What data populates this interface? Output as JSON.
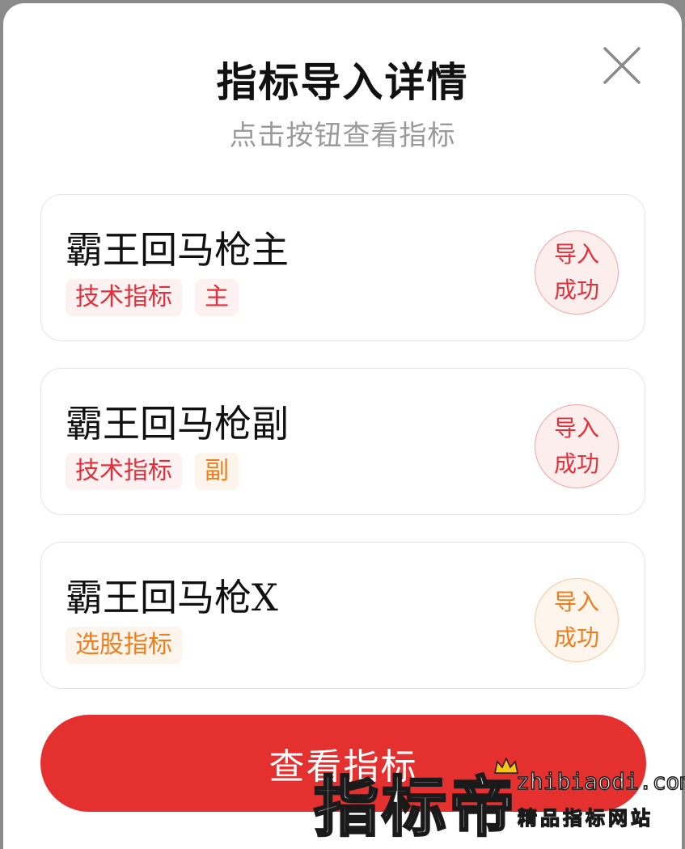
{
  "dialog": {
    "title": "指标导入详情",
    "subtitle": "点击按钮查看指标",
    "close_icon": "close-icon"
  },
  "indicators": [
    {
      "name": "霸王回马枪主",
      "tags": [
        {
          "label": "技术指标",
          "color": "#e0303a"
        },
        {
          "label": "主",
          "color": "#e0303a"
        }
      ],
      "status_line1": "导入",
      "status_line2": "成功",
      "status_color": "#e0303a"
    },
    {
      "name": "霸王回马枪副",
      "tags": [
        {
          "label": "技术指标",
          "color": "#e0303a"
        },
        {
          "label": "副",
          "color": "#f07d1c"
        }
      ],
      "status_line1": "导入",
      "status_line2": "成功",
      "status_color": "#e0303a"
    },
    {
      "name": "霸王回马枪X",
      "tags": [
        {
          "label": "选股指标",
          "color": "#f07d1c"
        }
      ],
      "status_line1": "导入",
      "status_line2": "成功",
      "status_color": "#f07d1c"
    }
  ],
  "actions": {
    "view_label": "查看指标",
    "accent_color": "#e53030"
  },
  "watermark": {
    "brand": "指标帝",
    "domain": "zhibiaodi.com",
    "slogan": "精品指标网站"
  }
}
